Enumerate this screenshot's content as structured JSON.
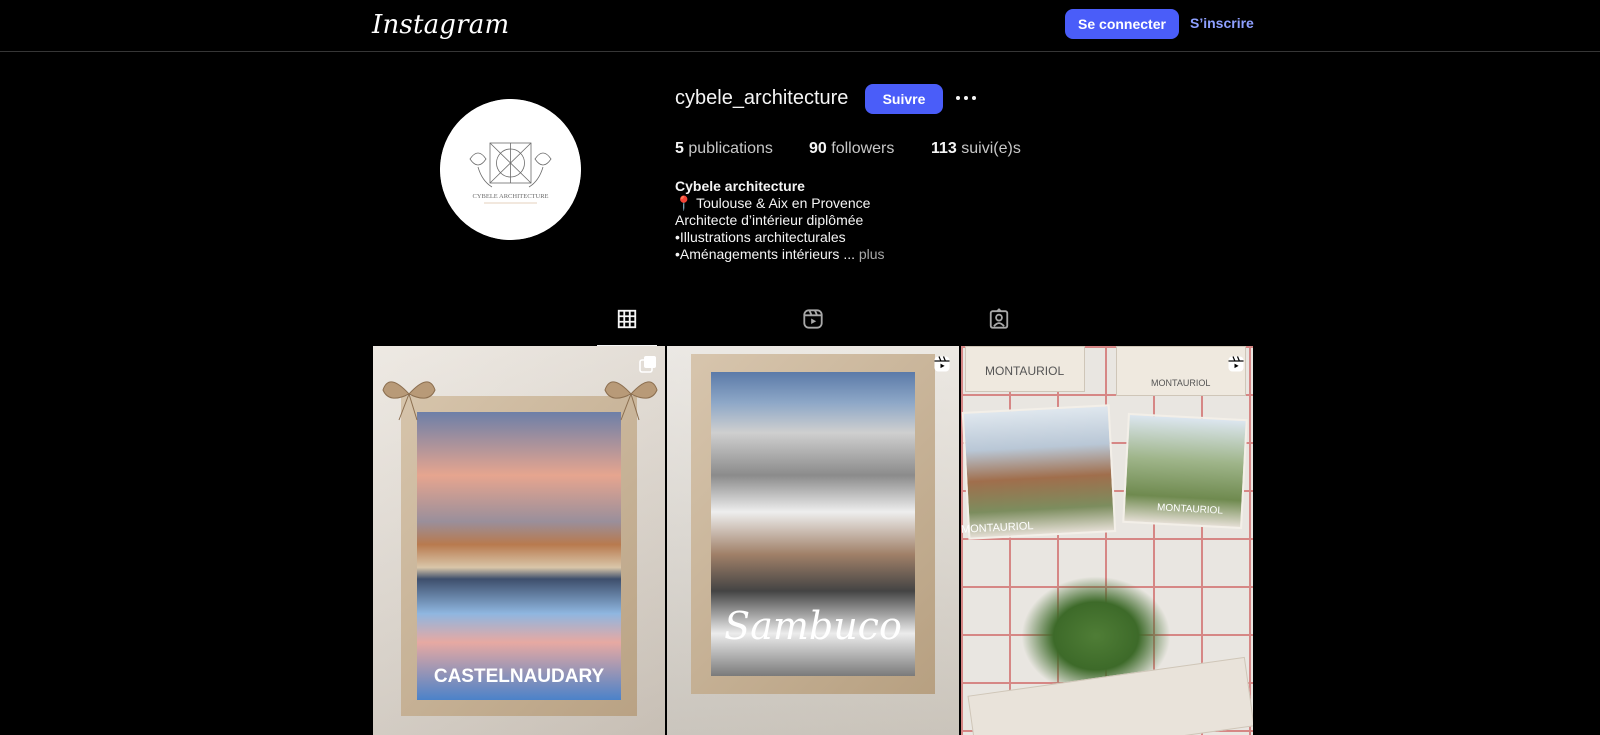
{
  "header": {
    "logo": "Instagram",
    "login_label": "Se connecter",
    "signup_label": "S’inscrire"
  },
  "profile": {
    "username": "cybele_architecture",
    "follow_label": "Suivre",
    "avatar_text": "CYBELE ARCHITECTURE",
    "stats": {
      "posts_count": "5",
      "posts_label": "publications",
      "followers_count": "90",
      "followers_label": "followers",
      "following_count": "113",
      "following_label": "suivi(e)s"
    },
    "bio": {
      "name": "Cybele architecture",
      "line1": "📍 Toulouse & Aix en Provence",
      "line2": "Architecte d’intérieur diplômée",
      "line3": "•Illustrations architecturales",
      "line4": "•Aménagements intérieurs ...",
      "more": "plus"
    }
  },
  "tabs": [
    {
      "icon": "grid-icon",
      "active": true
    },
    {
      "icon": "reels-icon",
      "active": false
    },
    {
      "icon": "tagged-icon",
      "active": false
    }
  ],
  "posts": [
    {
      "text": "CASTELNAUDARY",
      "badge": "carousel-icon"
    },
    {
      "text": "Sambuco",
      "badge": "reel-icon"
    },
    {
      "text": "MONTAURIOL",
      "text2": "MONTAURIOL",
      "text3": "MONTAURIOL",
      "text4": "MONTAURIOL",
      "badge": "reel-icon"
    }
  ],
  "colors": {
    "background": "#000000",
    "accent": "#4a5df9",
    "link": "#8ea0ff",
    "text": "#f5f5f5",
    "muted": "#a8a8a8"
  }
}
